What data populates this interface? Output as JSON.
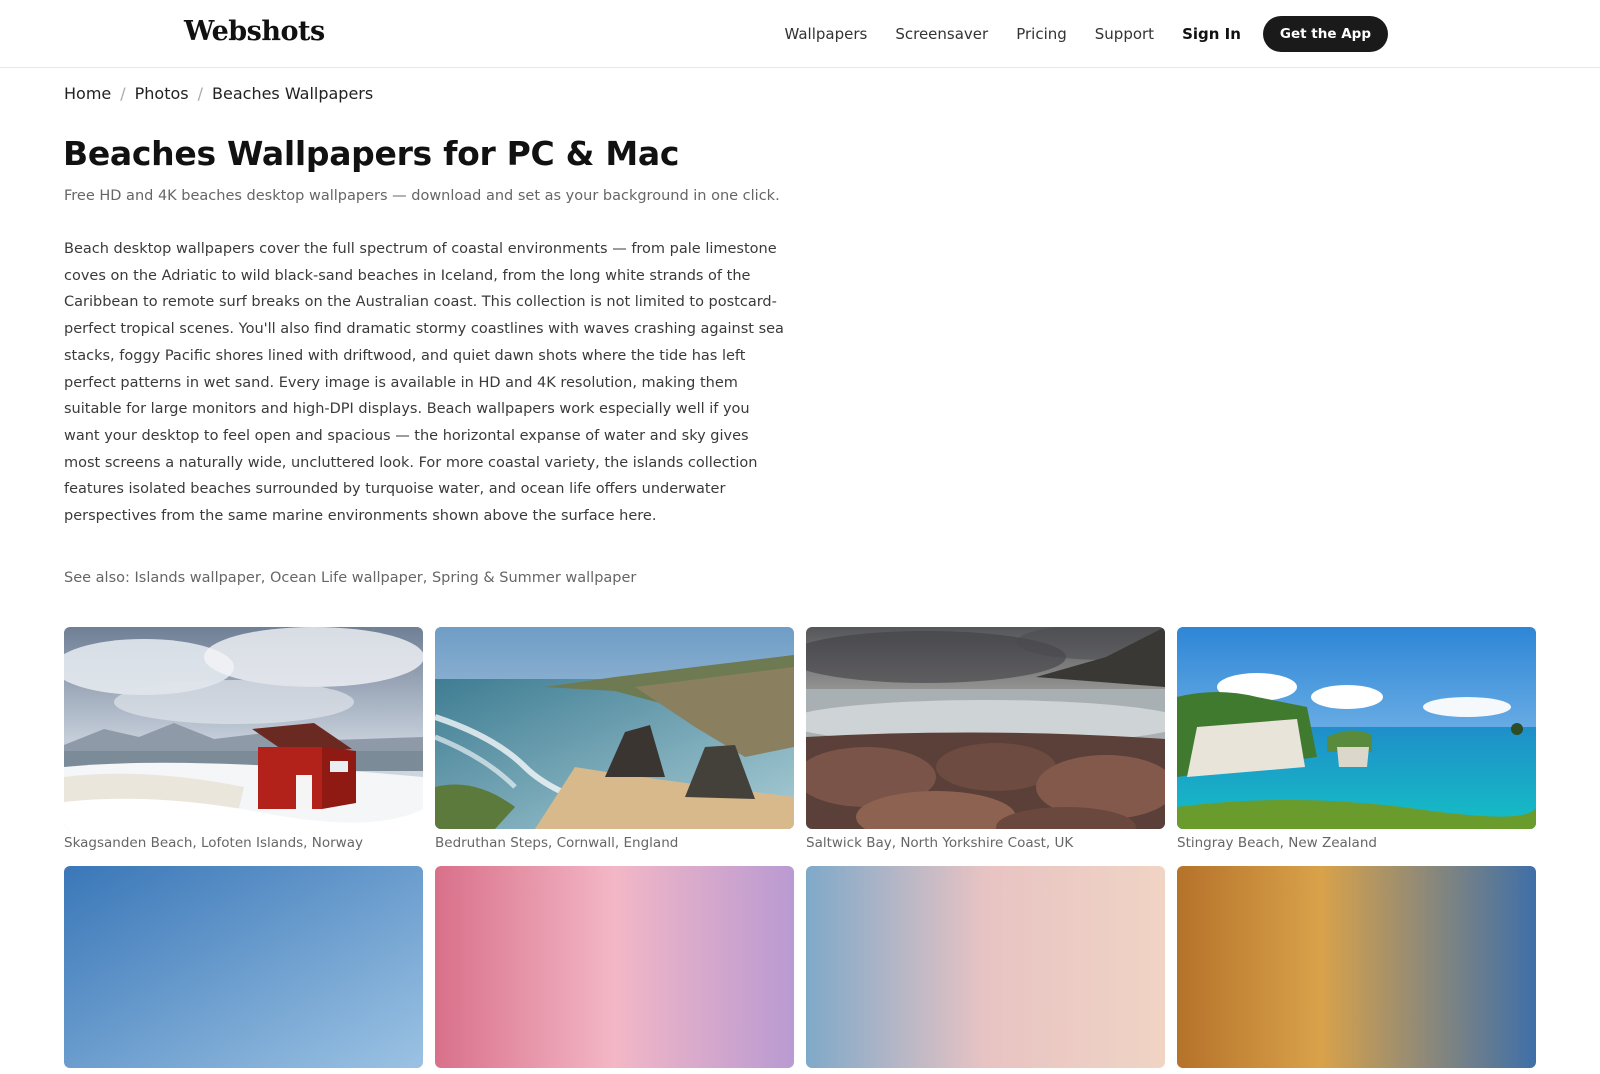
{
  "header": {
    "logo": "Webshots",
    "nav": [
      "Wallpapers",
      "Screensaver",
      "Pricing",
      "Support"
    ],
    "sign_in": "Sign In",
    "cta": "Get the App"
  },
  "breadcrumb": [
    "Home",
    "Photos",
    "Beaches Wallpapers"
  ],
  "page": {
    "title": "Beaches Wallpapers for PC & Mac",
    "subtitle": "Free HD and 4K beaches desktop wallpapers — download and set as your background in one click.",
    "description": "Beach desktop wallpapers cover the full spectrum of coastal environments — from pale limestone coves on the Adriatic to wild black-sand beaches in Iceland, from the long white strands of the Caribbean to remote surf breaks on the Australian coast. This collection is not limited to postcard-perfect tropical scenes. You'll also find dramatic stormy coastlines with waves crashing against sea stacks, foggy Pacific shores lined with driftwood, and quiet dawn shots where the tide has left perfect patterns in wet sand. Every image is available in HD and 4K resolution, making them suitable for large monitors and high-DPI displays. Beach wallpapers work especially well if you want your desktop to feel open and spacious — the horizontal expanse of water and sky gives most screens a naturally wide, uncluttered look. For more coastal variety, the islands collection features isolated beaches surrounded by turquoise water, and ocean life offers underwater perspectives from the same marine environments shown above the surface here.",
    "see_also_label": "See also:",
    "see_also_links": [
      "Islands wallpaper",
      "Ocean Life wallpaper",
      "Spring & Summer wallpaper"
    ]
  },
  "gallery": [
    {
      "caption": "Skagsanden Beach, Lofoten Islands, Norway"
    },
    {
      "caption": "Bedruthan Steps, Cornwall, England"
    },
    {
      "caption": "Saltwick Bay, North Yorkshire Coast, UK"
    },
    {
      "caption": "Stingray Beach, New Zealand"
    },
    {
      "caption": ""
    },
    {
      "caption": ""
    },
    {
      "caption": ""
    },
    {
      "caption": ""
    }
  ]
}
